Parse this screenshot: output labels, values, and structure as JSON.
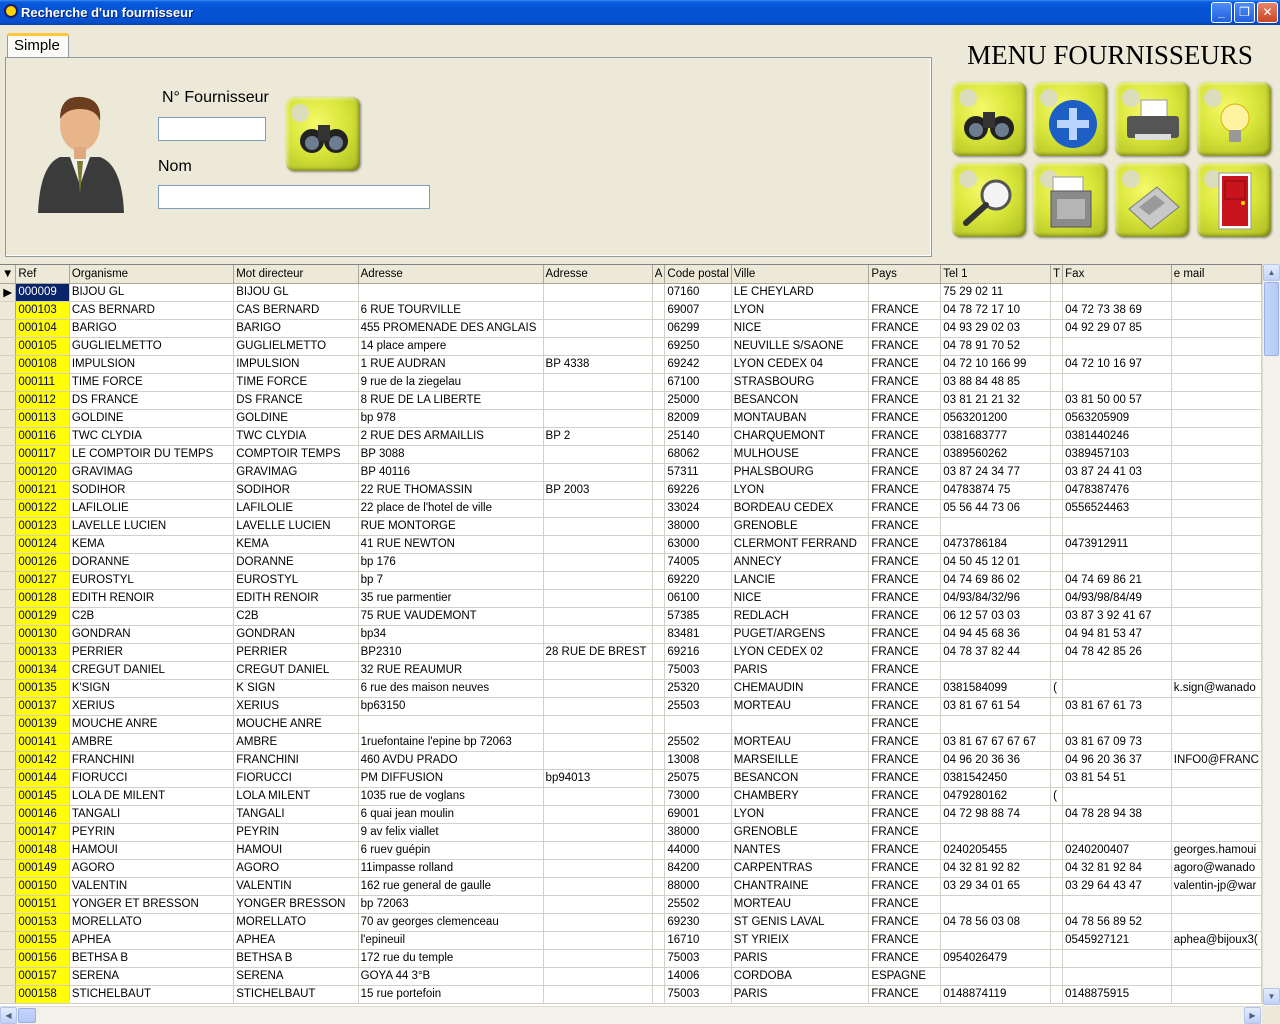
{
  "window": {
    "title": "Recherche d'un fournisseur"
  },
  "tabs": [
    {
      "label": "Simple"
    }
  ],
  "search": {
    "fournisseur_label": "N° Fournisseur",
    "fournisseur_value": "",
    "nom_label": "Nom",
    "nom_value": ""
  },
  "menu": {
    "title": "MENU FOURNISSEURS",
    "buttons": [
      "binoculars-icon",
      "globe-icon",
      "printer-icon",
      "lightbulb-icon",
      "magnifier-icon",
      "shredder-icon",
      "calculator-icon",
      "exit-door-icon"
    ]
  },
  "table": {
    "columns": [
      "Ref",
      "Organisme",
      "Mot directeur",
      "Adresse",
      "Adresse",
      "A",
      "Code postal",
      "Ville",
      "Pays",
      "Tel 1",
      "T",
      "Fax",
      "e mail"
    ],
    "rows": [
      [
        "000009",
        "BIJOU GL",
        "BIJOU GL",
        "",
        "",
        "",
        "07160",
        "LE CHEYLARD",
        "",
        "75 29 02 11",
        "",
        "",
        ""
      ],
      [
        "000103",
        "CAS BERNARD",
        "CAS BERNARD",
        "6 RUE TOURVILLE",
        "",
        "",
        "69007",
        "LYON",
        "FRANCE",
        "04 78 72 17 10",
        "",
        "04 72 73 38 69",
        ""
      ],
      [
        "000104",
        "BARIGO",
        "BARIGO",
        "455 PROMENADE DES ANGLAIS",
        "",
        "",
        "06299",
        "NICE",
        "FRANCE",
        "04 93 29 02 03",
        "",
        "04 92 29 07 85",
        ""
      ],
      [
        "000105",
        "GUGLIELMETTO",
        "GUGLIELMETTO",
        "14 place ampere",
        "",
        "",
        "69250",
        "NEUVILLE S/SAONE",
        "FRANCE",
        "04 78 91 70 52",
        "",
        "",
        ""
      ],
      [
        "000108",
        "IMPULSION",
        "IMPULSION",
        "1 RUE AUDRAN",
        "BP 4338",
        "",
        "69242",
        "LYON CEDEX 04",
        "FRANCE",
        "04 72 10 166 99",
        "",
        "04 72 10 16 97",
        ""
      ],
      [
        "000111",
        "TIME FORCE",
        "TIME FORCE",
        "9 rue de la ziegelau",
        "",
        "",
        "67100",
        "STRASBOURG",
        "FRANCE",
        "03 88 84 48 85",
        "",
        "",
        ""
      ],
      [
        "000112",
        "DS FRANCE",
        "DS FRANCE",
        "8 RUE DE LA LIBERTE",
        "",
        "",
        "25000",
        "BESANCON",
        "FRANCE",
        "03 81 21 21 32",
        "",
        "03 81 50 00 57",
        ""
      ],
      [
        "000113",
        "GOLDINE",
        "GOLDINE",
        "bp 978",
        "",
        "",
        "82009",
        "MONTAUBAN",
        "FRANCE",
        "0563201200",
        "",
        "0563205909",
        ""
      ],
      [
        "000116",
        "TWC CLYDIA",
        "TWC CLYDIA",
        "2 RUE DES ARMAILLIS",
        "BP 2",
        "",
        "25140",
        "CHARQUEMONT",
        "FRANCE",
        "0381683777",
        "",
        "0381440246",
        ""
      ],
      [
        "000117",
        "LE COMPTOIR DU TEMPS",
        "COMPTOIR TEMPS",
        "BP 3088",
        "",
        "",
        "68062",
        "MULHOUSE",
        "FRANCE",
        "0389560262",
        "",
        "0389457103",
        ""
      ],
      [
        "000120",
        "GRAVIMAG",
        "GRAVIMAG",
        "BP 40116",
        "",
        "",
        "57311",
        "PHALSBOURG",
        "FRANCE",
        "03 87 24 34 77",
        "",
        "03 87 24 41 03",
        ""
      ],
      [
        "000121",
        "SODIHOR",
        "SODIHOR",
        "22 RUE THOMASSIN",
        "BP 2003",
        "",
        "69226",
        "LYON",
        "FRANCE",
        "04783874 75",
        "",
        "0478387476",
        ""
      ],
      [
        "000122",
        "LAFILOLIE",
        "LAFILOLIE",
        "22 place de l'hotel de ville",
        "",
        "",
        "33024",
        "BORDEAU CEDEX",
        "FRANCE",
        "05 56 44 73 06",
        "",
        "0556524463",
        ""
      ],
      [
        "000123",
        "LAVELLE LUCIEN",
        "LAVELLE LUCIEN",
        "RUE MONTORGE",
        "",
        "",
        "38000",
        "GRENOBLE",
        "FRANCE",
        "",
        "",
        "",
        ""
      ],
      [
        "000124",
        "KEMA",
        "KEMA",
        "41 RUE NEWTON",
        "",
        "",
        "63000",
        "CLERMONT FERRAND",
        "FRANCE",
        "0473786184",
        "",
        "0473912911",
        ""
      ],
      [
        "000126",
        "DORANNE",
        "DORANNE",
        "bp 176",
        "",
        "",
        "74005",
        "ANNECY",
        "FRANCE",
        "04 50 45 12 01",
        "",
        "",
        ""
      ],
      [
        "000127",
        "EUROSTYL",
        "EUROSTYL",
        "bp 7",
        "",
        "",
        "69220",
        "LANCIE",
        "FRANCE",
        "04 74 69 86 02",
        "",
        "04 74 69 86 21",
        ""
      ],
      [
        "000128",
        "EDITH RENOIR",
        "EDITH RENOIR",
        "35 rue parmentier",
        "",
        "",
        "06100",
        "NICE",
        "FRANCE",
        "04/93/84/32/96",
        "",
        "04/93/98/84/49",
        ""
      ],
      [
        "000129",
        "C2B",
        "C2B",
        "75 RUE VAUDEMONT",
        "",
        "",
        "57385",
        "REDLACH",
        "FRANCE",
        "06 12 57 03 03",
        "",
        "03 87 3 92 41 67",
        ""
      ],
      [
        "000130",
        "GONDRAN",
        "GONDRAN",
        "bp34",
        "",
        "",
        "83481",
        "PUGET/ARGENS",
        "FRANCE",
        "04 94 45 68 36",
        "",
        "04 94 81 53 47",
        ""
      ],
      [
        "000133",
        "PERRIER",
        "PERRIER",
        "BP2310",
        "28 RUE DE BREST",
        "",
        "69216",
        "LYON CEDEX 02",
        "FRANCE",
        "04 78 37 82 44",
        "",
        "04 78 42 85 26",
        ""
      ],
      [
        "000134",
        "CREGUT DANIEL",
        "CREGUT DANIEL",
        "32 RUE REAUMUR",
        "",
        "",
        "75003",
        "PARIS",
        "FRANCE",
        "",
        "",
        "",
        ""
      ],
      [
        "000135",
        "K'SIGN",
        "K SIGN",
        "6 rue des maison neuves",
        "",
        "",
        "25320",
        "CHEMAUDIN",
        "FRANCE",
        "0381584099",
        "(",
        "",
        "k.sign@wanado"
      ],
      [
        "000137",
        "XERIUS",
        "XERIUS",
        "bp63150",
        "",
        "",
        "25503",
        "MORTEAU",
        "FRANCE",
        "03 81 67 61 54",
        "",
        "03 81 67 61 73",
        ""
      ],
      [
        "000139",
        "MOUCHE ANRE",
        "MOUCHE ANRE",
        "",
        "",
        "",
        "",
        "",
        "FRANCE",
        "",
        "",
        "",
        ""
      ],
      [
        "000141",
        "AMBRE",
        "AMBRE",
        "1ruefontaine l'epine   bp 72063",
        "",
        "",
        "25502",
        "MORTEAU",
        "FRANCE",
        "03 81 67 67 67 67",
        "",
        "03 81 67 09 73",
        ""
      ],
      [
        "000142",
        "FRANCHINI",
        "FRANCHINI",
        "460 AVDU PRADO",
        "",
        "",
        "13008",
        "MARSEILLE",
        "FRANCE",
        "04 96 20 36 36",
        "",
        "04 96 20 36 37",
        "INFO0@FRANC"
      ],
      [
        "000144",
        "FIORUCCI",
        "FIORUCCI",
        "PM DIFFUSION",
        "bp94013",
        "",
        "25075",
        "BESANCON",
        "FRANCE",
        "0381542450",
        "",
        "03 81 54 51",
        ""
      ],
      [
        "000145",
        "LOLA DE MILENT",
        "LOLA MILENT",
        "1035 rue de voglans",
        "",
        "",
        "73000",
        "CHAMBERY",
        "FRANCE",
        "0479280162",
        "(",
        "",
        ""
      ],
      [
        "000146",
        "TANGALI",
        "TANGALI",
        "6 quai jean moulin",
        "",
        "",
        "69001",
        "LYON",
        "FRANCE",
        "04 72 98 88 74",
        "",
        "04 78 28 94 38",
        ""
      ],
      [
        "000147",
        "PEYRIN",
        "PEYRIN",
        "9 av felix viallet",
        "",
        "",
        "38000",
        "GRENOBLE",
        "FRANCE",
        "",
        "",
        "",
        ""
      ],
      [
        "000148",
        "HAMOUI",
        "HAMOUI",
        "6 ruev guépin",
        "",
        "",
        "44000",
        "NANTES",
        "FRANCE",
        "0240205455",
        "",
        "0240200407",
        "georges.hamoui"
      ],
      [
        "000149",
        "AGORO",
        "AGORO",
        "11impasse rolland",
        "",
        "",
        "84200",
        "CARPENTRAS",
        "FRANCE",
        "04 32 81 92 82",
        "",
        "04 32 81 92 84",
        "agoro@wanado"
      ],
      [
        "000150",
        "VALENTIN",
        "VALENTIN",
        "162 rue general de gaulle",
        "",
        "",
        "88000",
        "CHANTRAINE",
        "FRANCE",
        "03 29 34 01 65",
        "",
        "03 29 64 43 47",
        "valentin-jp@war"
      ],
      [
        "000151",
        "YONGER ET BRESSON",
        "YONGER BRESSON",
        "bp 72063",
        "",
        "",
        "25502",
        "MORTEAU",
        "FRANCE",
        "",
        "",
        "",
        ""
      ],
      [
        "000153",
        "MORELLATO",
        "MORELLATO",
        "70 av georges clemenceau",
        "",
        "",
        "69230",
        "ST GENIS LAVAL",
        "FRANCE",
        "04 78 56 03 08",
        "",
        "04 78 56 89 52",
        ""
      ],
      [
        "000155",
        "APHEA",
        "APHEA",
        "l'epineuil",
        "",
        "",
        "16710",
        "ST YRIEIX",
        "FRANCE",
        "",
        "",
        "0545927121",
        "aphea@bijoux3("
      ],
      [
        "000156",
        "BETHSA B",
        "BETHSA B",
        "172 rue du temple",
        "",
        "",
        "75003",
        "PARIS",
        "FRANCE",
        "0954026479",
        "",
        "",
        ""
      ],
      [
        "000157",
        "SERENA",
        "SERENA",
        "GOYA 44 3°B",
        "",
        "",
        "14006",
        "CORDOBA",
        "ESPAGNE",
        "",
        "",
        "",
        ""
      ],
      [
        "000158",
        "STICHELBAUT",
        "STICHELBAUT",
        "15 rue portefoin",
        "",
        "",
        "75003",
        "PARIS",
        "FRANCE",
        "0148874119",
        "",
        "0148875915",
        ""
      ]
    ]
  }
}
